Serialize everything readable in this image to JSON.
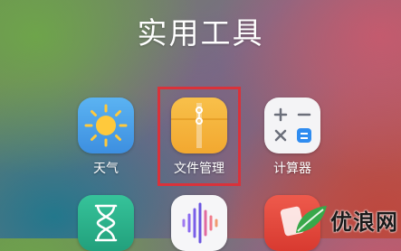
{
  "folder": {
    "title": "实用工具"
  },
  "apps": [
    {
      "label": "天气",
      "icon": "weather-sun-icon"
    },
    {
      "label": "文件管理",
      "icon": "file-manager-icon",
      "highlighted": true
    },
    {
      "label": "计算器",
      "icon": "calculator-icon"
    },
    {
      "label": "",
      "icon": "hourglass-icon"
    },
    {
      "label": "",
      "icon": "audio-wave-icon"
    },
    {
      "label": "",
      "icon": "red-app-icon"
    }
  ],
  "watermark": {
    "text": "优浪网"
  },
  "colors": {
    "highlight": "#d9323a",
    "weather": "#4aa0e8",
    "files": "#f6b73c",
    "calculator": "#2f8cf0",
    "hourglass": "#2fb08a",
    "voice": "#6b55e0",
    "red": "#e04a3f"
  }
}
